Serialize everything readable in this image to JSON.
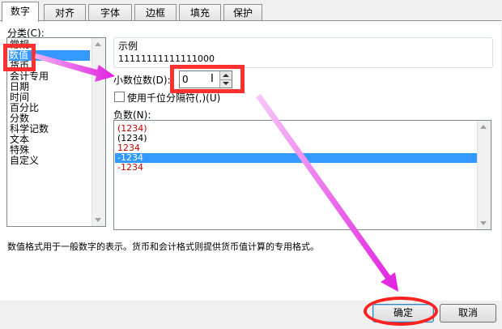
{
  "tabs": [
    {
      "label": "数字",
      "active": true
    },
    {
      "label": "对齐",
      "active": false
    },
    {
      "label": "字体",
      "active": false
    },
    {
      "label": "边框",
      "active": false
    },
    {
      "label": "填充",
      "active": false
    },
    {
      "label": "保护",
      "active": false
    }
  ],
  "category": {
    "label": "分类(C):",
    "items": [
      "常规",
      "数值",
      "货币",
      "会计专用",
      "日期",
      "时间",
      "百分比",
      "分数",
      "科学记数",
      "文本",
      "特殊",
      "自定义"
    ],
    "selected": "数值"
  },
  "sample": {
    "label": "示例",
    "value": "11111111111111000"
  },
  "decimal": {
    "label": "小数位数(D):",
    "value": "0"
  },
  "thousands": {
    "label": "使用千位分隔符(,)(U)",
    "checked": false
  },
  "negative": {
    "label": "负数(N):",
    "items": [
      {
        "text": "(1234)",
        "color": "#c00000"
      },
      {
        "text": "(1234)",
        "color": "#000000"
      },
      {
        "text": "1234",
        "color": "#c00000"
      },
      {
        "text": "-1234",
        "color": "#000000",
        "selected": true
      },
      {
        "text": "-1234",
        "color": "#c00000"
      }
    ]
  },
  "description": "数值格式用于一般数字的表示。货币和会计格式则提供货币值计算的专用格式。",
  "buttons": {
    "ok": "确定",
    "cancel": "取消"
  },
  "colors": {
    "highlight": "#3399ff",
    "annotation_red": "#ff3030",
    "annotation_magenta": "#e030e0"
  }
}
